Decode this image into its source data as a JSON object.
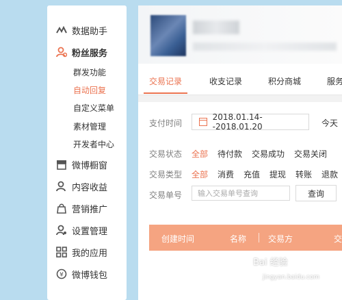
{
  "sidebar": {
    "items": [
      {
        "label": "数据助手",
        "icon": "wave-chart-icon"
      },
      {
        "label": "粉丝服务",
        "icon": "fans-icon"
      },
      {
        "label": "微博橱窗",
        "icon": "shop-window-icon"
      },
      {
        "label": "内容收益",
        "icon": "user-income-icon"
      },
      {
        "label": "营销推广",
        "icon": "bag-icon"
      },
      {
        "label": "设置管理",
        "icon": "user-settings-icon"
      },
      {
        "label": "我的应用",
        "icon": "grid-apps-icon"
      },
      {
        "label": "微博钱包",
        "icon": "wallet-icon"
      }
    ],
    "sub_items": [
      "群发功能",
      "自动回复",
      "自定义菜单",
      "素材管理",
      "开发者中心"
    ],
    "active_item": "粉丝服务",
    "active_sub": "自动回复"
  },
  "tabs": [
    "交易记录",
    "收支记录",
    "积分商城",
    "服务"
  ],
  "filters": {
    "pay_time_label": "支付时间",
    "date_range": "2018.01.14--2018.01.20",
    "today": "今天",
    "status_label": "交易状态",
    "status_options": [
      "全部",
      "待付款",
      "交易成功",
      "交易关闭"
    ],
    "type_label": "交易类型",
    "type_options": [
      "全部",
      "消费",
      "充值",
      "提现",
      "转账",
      "退款"
    ],
    "order_label": "交易单号",
    "order_placeholder": "输入交易单号查询",
    "query_button": "查询"
  },
  "table": {
    "headers": [
      "创建时间",
      "名称",
      "交易方",
      "交"
    ]
  },
  "watermark": {
    "text": "Bai 经验",
    "sub": "jingyan.baidu.com"
  },
  "colors": {
    "accent": "#eb7350",
    "table_header": "#f5a481",
    "background": "#b9dcef"
  }
}
